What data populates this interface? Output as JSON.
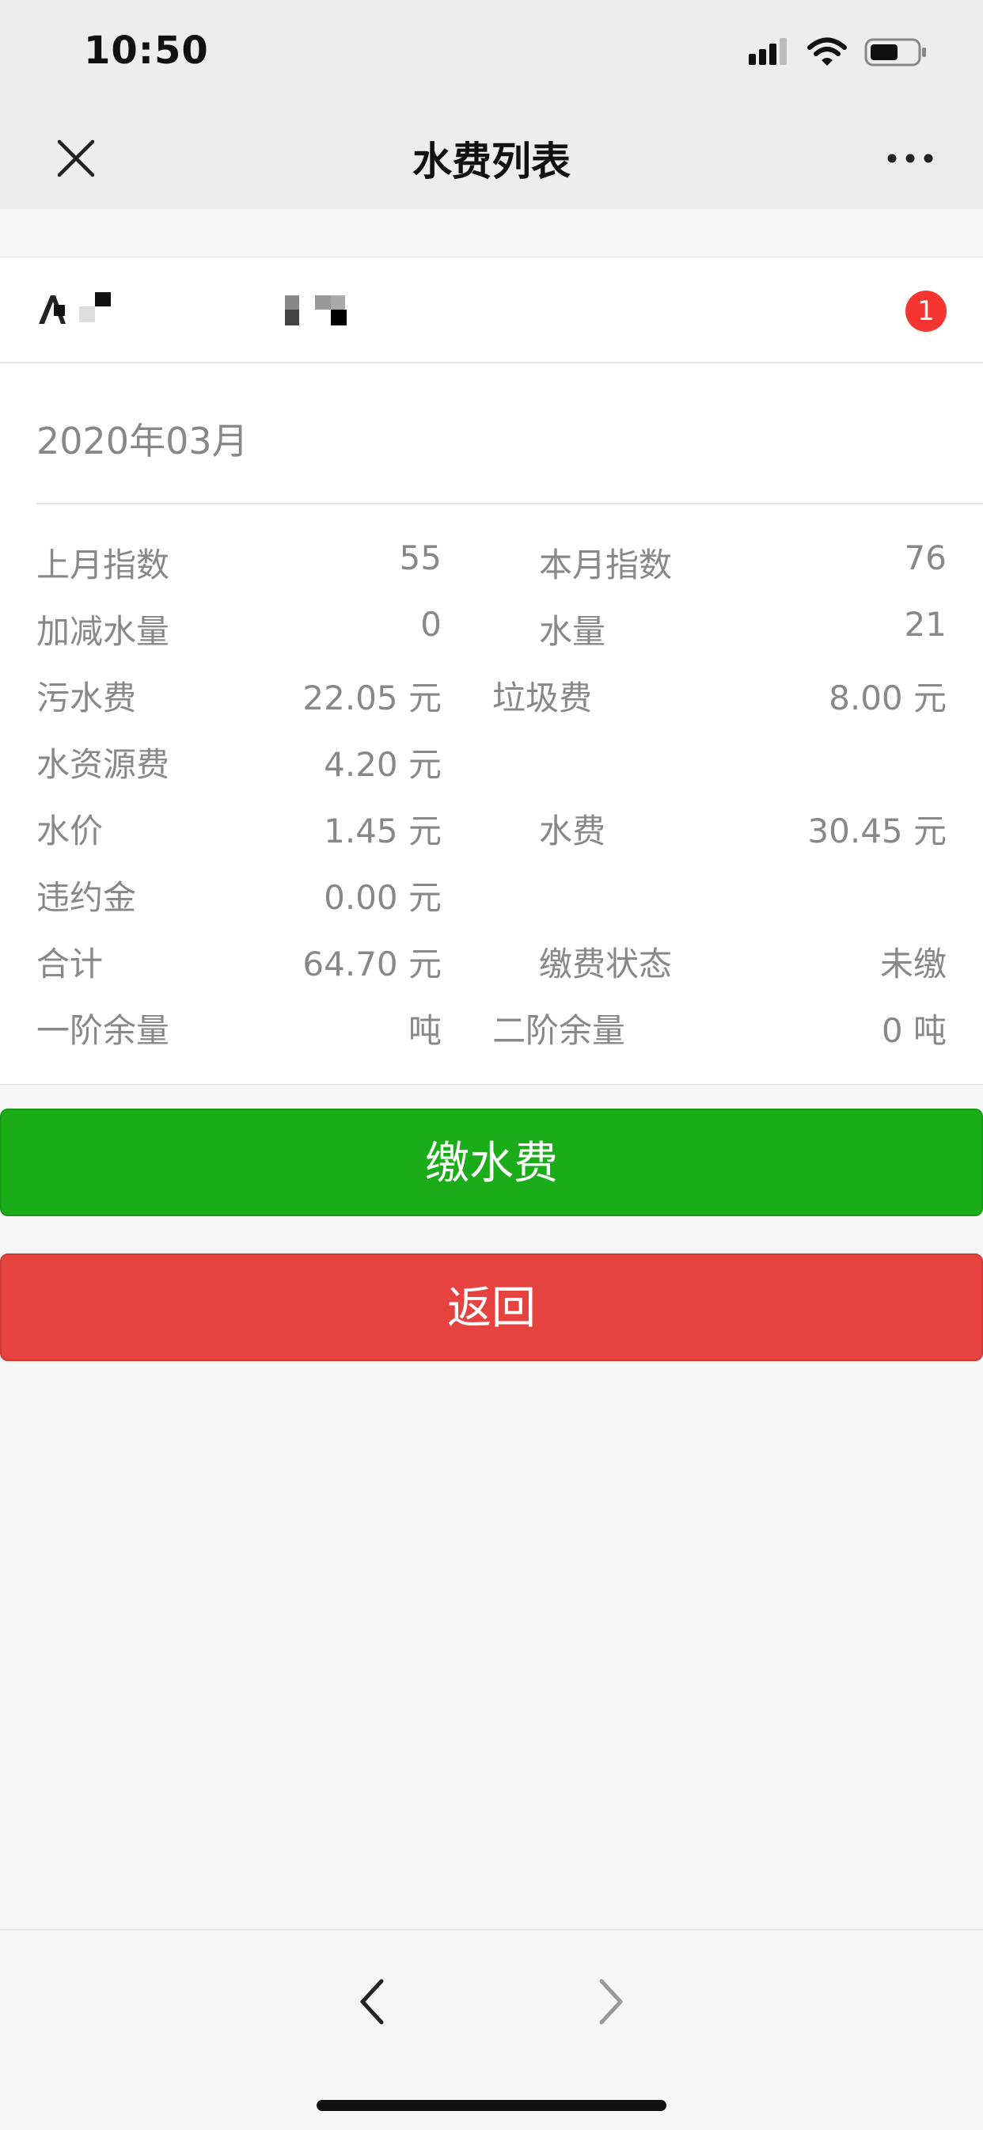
{
  "status_bar": {
    "time": "10:50"
  },
  "nav": {
    "title": "水费列表"
  },
  "account": {
    "badge_count": "1"
  },
  "bill": {
    "month": "2020年03月",
    "fields": [
      {
        "label": "上月指数",
        "value": "55"
      },
      {
        "label": "本月指数",
        "value": "76"
      },
      {
        "label": "加减水量",
        "value": "0"
      },
      {
        "label": "水量",
        "value": "21"
      },
      {
        "label": "污水费",
        "value": "22.05 元"
      },
      {
        "label": "垃圾费",
        "value": "8.00 元"
      },
      {
        "label": "水资源费",
        "value": "4.20 元"
      },
      {
        "label": "水价",
        "value": "1.45 元"
      },
      {
        "label": "水费",
        "value": "30.45 元"
      },
      {
        "label": "违约金",
        "value": "0.00 元"
      },
      {
        "label": "合计",
        "value": "64.70 元"
      },
      {
        "label": "缴费状态",
        "value": "未缴"
      },
      {
        "label": "一阶余量",
        "value": "吨"
      },
      {
        "label": "二阶余量",
        "value": "0 吨"
      }
    ]
  },
  "actions": {
    "pay_label": "缴水费",
    "back_label": "返回"
  },
  "colors": {
    "pay_green": "#1aad19",
    "back_red": "#e64340",
    "badge_red": "#f43530"
  }
}
